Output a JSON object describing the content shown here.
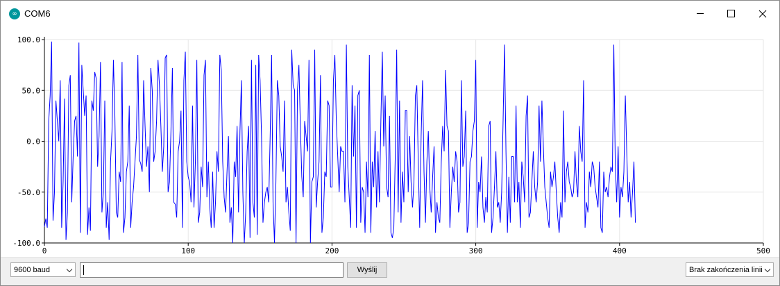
{
  "window": {
    "title": "COM6",
    "icon": "arduino-icon",
    "icon_text": "∞",
    "controls": [
      "minimize-icon",
      "maximize-icon",
      "close-icon"
    ]
  },
  "bottom_bar": {
    "baud_value": "9600 baud",
    "input_value": "",
    "send_label": "Wyślij",
    "line_ending_value": "Brak zakończenia linii"
  },
  "colors": {
    "series": "#0000ff",
    "grid": "#e6e6e6",
    "axis": "#000000",
    "bar_bg": "#f0f0f0"
  },
  "chart_data": {
    "type": "line",
    "title": "",
    "xlabel": "",
    "ylabel": "",
    "xlim": [
      0,
      500
    ],
    "ylim": [
      -100,
      100
    ],
    "x_ticks": [
      0,
      100,
      200,
      300,
      400,
      500
    ],
    "x_tick_labels": [
      "0",
      "100",
      "200",
      "300",
      "400",
      "500"
    ],
    "y_ticks": [
      100,
      50,
      0,
      -50,
      -100
    ],
    "y_tick_labels": [
      "100.0",
      "50.0",
      "0.0",
      "-50.0",
      "-100.0"
    ],
    "grid": true,
    "legend": "none",
    "series": [
      {
        "values": [
          -84,
          -76,
          -85,
          20,
          45,
          98,
          -78,
          -50,
          40,
          20,
          0,
          60,
          -85,
          -40,
          42,
          -97,
          -70,
          55,
          65,
          -60,
          -15,
          20,
          25,
          -15,
          97,
          -90,
          75,
          50,
          25,
          45,
          -92,
          -65,
          -88,
          40,
          30,
          68,
          62,
          -25,
          5,
          78,
          -70,
          -50,
          40,
          -85,
          -60,
          -97,
          -20,
          10,
          80,
          25,
          -70,
          -75,
          -30,
          -40,
          78,
          -90,
          -75,
          -30,
          -20,
          35,
          -85,
          -60,
          -45,
          -20,
          5,
          85,
          -18,
          -22,
          -30,
          60,
          15,
          -25,
          -5,
          -50,
          72,
          50,
          -20,
          -10,
          20,
          80,
          55,
          15,
          -30,
          -5,
          82,
          85,
          -50,
          -40,
          10,
          72,
          -60,
          -62,
          -75,
          -10,
          0,
          30,
          -85,
          60,
          88,
          -20,
          -35,
          -40,
          -60,
          35,
          -65,
          -20,
          80,
          -80,
          -70,
          -25,
          -45,
          65,
          80,
          -55,
          -20,
          -65,
          -85,
          -30,
          -85,
          -60,
          -10,
          -30,
          85,
          70,
          -20,
          -55,
          -70,
          -30,
          5,
          -80,
          -65,
          -100,
          -20,
          -35,
          15,
          -70,
          10,
          60,
          -50,
          -100,
          -70,
          -10,
          15,
          -95,
          80,
          -60,
          -75,
          75,
          -92,
          85,
          60,
          5,
          -80,
          -60,
          -50,
          -45,
          -60,
          5,
          85,
          -60,
          -100,
          -40,
          60,
          45,
          -5,
          -15,
          -30,
          40,
          -60,
          -45,
          -70,
          -88,
          90,
          55,
          50,
          -100,
          50,
          75,
          15,
          -35,
          -55,
          20,
          5,
          -10,
          80,
          -100,
          -40,
          -35,
          90,
          -65,
          -40,
          -20,
          65,
          -90,
          -75,
          -30,
          -35,
          40,
          35,
          -45,
          -45,
          60,
          85,
          20,
          -15,
          -50,
          -5,
          -10,
          -10,
          -60,
          95,
          -25,
          -55,
          -85,
          55,
          -15,
          35,
          -85,
          45,
          50,
          -80,
          -45,
          -50,
          -90,
          -20,
          -55,
          85,
          -90,
          -20,
          -45,
          10,
          -65,
          -10,
          -60,
          20,
          88,
          -5,
          45,
          -45,
          -55,
          25,
          -90,
          -95,
          -85,
          -15,
          90,
          -70,
          40,
          -80,
          -30,
          -60,
          30,
          30,
          -50,
          5,
          -40,
          -65,
          -40,
          45,
          55,
          -20,
          -85,
          5,
          60,
          -30,
          -80,
          -20,
          10,
          -45,
          -70,
          -35,
          -5,
          -90,
          -60,
          -75,
          -80,
          -20,
          15,
          -10,
          70,
          15,
          10,
          -85,
          -50,
          -25,
          -40,
          -10,
          -20,
          -70,
          -60,
          60,
          -25,
          -15,
          30,
          -90,
          -80,
          -20,
          -15,
          10,
          20,
          80,
          -85,
          -40,
          -50,
          -15,
          -65,
          -80,
          -55,
          -70,
          15,
          20,
          -90,
          -75,
          -45,
          -10,
          -65,
          -60,
          -80,
          -50,
          20,
          95,
          -10,
          -90,
          -35,
          -80,
          -15,
          -15,
          -60,
          35,
          -60,
          -40,
          -85,
          -20,
          -35,
          -60,
          25,
          45,
          -75,
          -70,
          -40,
          -10,
          -45,
          -60,
          -40,
          35,
          -20,
          40,
          -5,
          -45,
          -60,
          -75,
          -85,
          -30,
          -45,
          -35,
          -20,
          -50,
          -75,
          -90,
          -60,
          -75,
          30,
          -60,
          -30,
          -20,
          -40,
          -45,
          -55,
          -50,
          -10,
          -40,
          -55,
          15,
          -10,
          -20,
          60,
          -85,
          -60,
          -70,
          -30,
          -45,
          -20,
          -25,
          -45,
          -55,
          -65,
          -20,
          -85,
          -90,
          -30,
          -50,
          -45,
          -55,
          -35,
          -25,
          -30,
          95,
          -20,
          -60,
          -5,
          -75,
          -45,
          -55,
          -30,
          45,
          -10,
          -60,
          -40,
          -75,
          -50,
          -20,
          -80
        ]
      }
    ]
  }
}
